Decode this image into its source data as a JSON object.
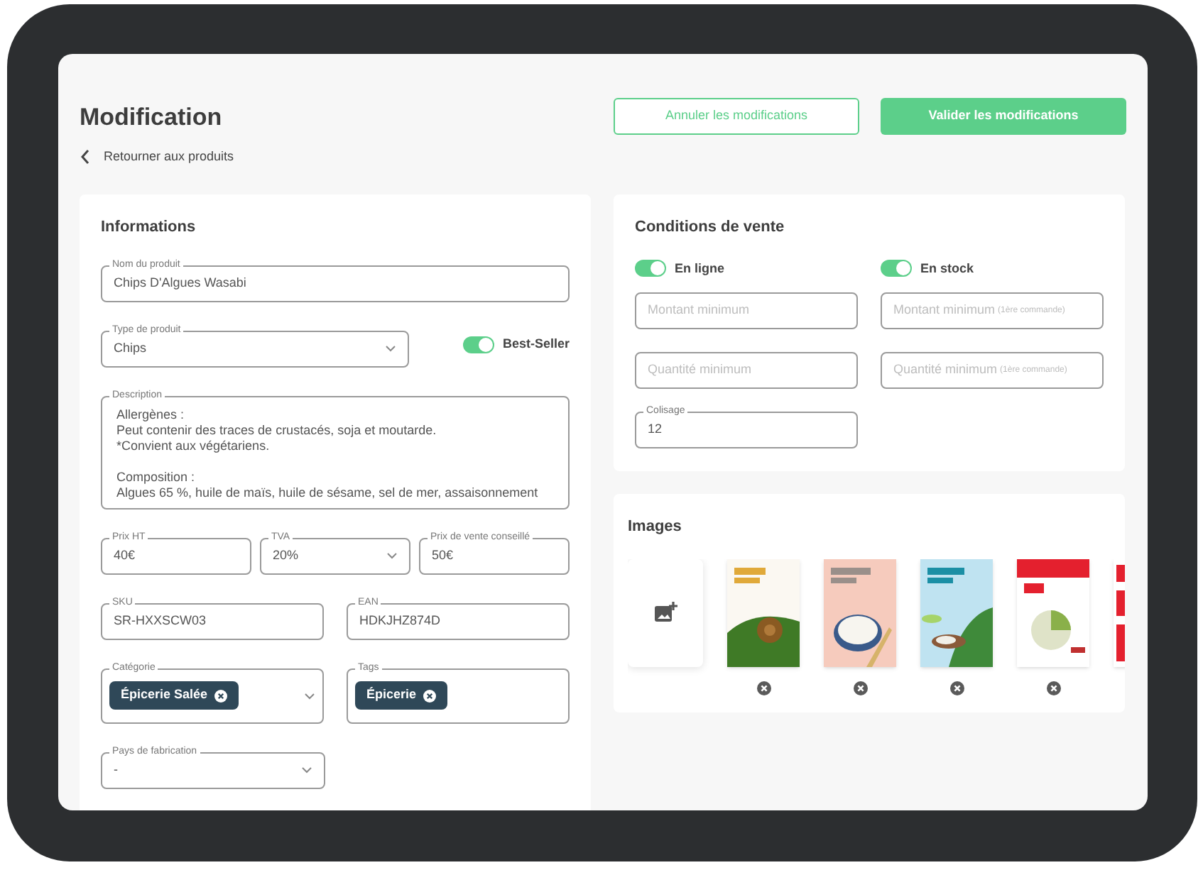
{
  "header": {
    "title": "Modification",
    "back_link": "Retourner aux produits",
    "buttons": [
      {
        "label": "Annuler les modifications",
        "kind": "outline"
      },
      {
        "label": "Valider les modifications",
        "kind": "primary"
      }
    ]
  },
  "informations": {
    "title": "Informations",
    "product_name": {
      "label": "Nom du produit",
      "value": "Chips D'Algues Wasabi"
    },
    "product_type": {
      "label": "Type de produit",
      "value": "Chips"
    },
    "best_seller": {
      "label": "Best-Seller",
      "on": true
    },
    "description": {
      "label": "Description",
      "paragraphs": [
        [
          "Allergènes :",
          "Peut contenir des traces de crustacés, soja et moutarde.",
          "*Convient aux végétariens."
        ],
        [
          "Composition :",
          "Algues 65 %, huile de maïs, huile de sésame, sel de mer, assaisonnement"
        ]
      ]
    },
    "prices": [
      {
        "label": "Prix HT",
        "value": "40€",
        "kind": "text"
      },
      {
        "label": "TVA",
        "value": "20%",
        "kind": "select"
      },
      {
        "label": "Prix de vente conseillé",
        "value": "50€",
        "kind": "text"
      }
    ],
    "codes": [
      {
        "label": "SKU",
        "value": "SR-HXXSCW03"
      },
      {
        "label": "EAN",
        "value": "HDKJHZ874D"
      }
    ],
    "chip_fields": [
      {
        "label": "Catégorie",
        "kind": "select",
        "chips": [
          "Épicerie Salée"
        ]
      },
      {
        "label": "Tags",
        "kind": "text",
        "chips": [
          "Épicerie"
        ]
      }
    ],
    "country": {
      "label": "Pays de fabrication",
      "value": "-"
    }
  },
  "conditions": {
    "title": "Conditions de vente",
    "toggles": [
      {
        "label": "En ligne",
        "on": true
      },
      {
        "label": "En stock",
        "on": true
      }
    ],
    "fields": [
      {
        "placeholder": "Montant minimum"
      },
      {
        "placeholder": "Montant minimum",
        "note": "(1ère commande)"
      },
      {
        "placeholder": "Quantité minimum"
      },
      {
        "placeholder": "Quantité minimum",
        "note": "(1ère commande)"
      },
      {
        "label": "Colisage",
        "value": "12"
      }
    ]
  },
  "images": {
    "title": "Images",
    "items": [
      {
        "kind": "picture",
        "removable": true
      },
      {
        "kind": "picture",
        "removable": true
      },
      {
        "kind": "picture",
        "removable": true
      },
      {
        "kind": "picture",
        "removable": true
      },
      {
        "kind": "picture",
        "removable": false
      }
    ]
  }
}
